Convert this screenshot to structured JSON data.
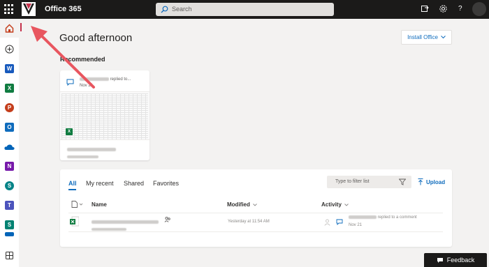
{
  "topbar": {
    "app_name": "Office 365",
    "search_placeholder": "Search",
    "icons": [
      "waffle-icon",
      "org-logo",
      "search-icon",
      "whats-new-icon",
      "settings-icon",
      "help-icon",
      "avatar"
    ],
    "help_label": "?"
  },
  "rail": {
    "items": [
      {
        "name": "home",
        "color": "#c43e1c"
      },
      {
        "name": "create",
        "color": "#323130"
      },
      {
        "name": "word",
        "color": "#185abd",
        "letter": "W"
      },
      {
        "name": "excel",
        "color": "#107c41",
        "letter": "X"
      },
      {
        "name": "powerpoint",
        "color": "#c43e1c",
        "letter": "P"
      },
      {
        "name": "outlook",
        "color": "#0f6cbd",
        "letter": "O"
      },
      {
        "name": "onedrive",
        "color": "#0364b8"
      },
      {
        "name": "onenote",
        "color": "#7719aa",
        "letter": "N"
      },
      {
        "name": "sharepoint",
        "color": "#038387",
        "letter": "S"
      },
      {
        "name": "teams",
        "color": "#4b53bc",
        "letter": "T"
      },
      {
        "name": "sway",
        "color": "#008272",
        "letter": "S"
      },
      {
        "name": "all-apps",
        "color": "#323130"
      }
    ]
  },
  "main": {
    "greeting": "Good afternoon",
    "install_label": "Install Office",
    "recommended_label": "Recommended",
    "card": {
      "activity": "replied to...",
      "date": "Nov 21"
    }
  },
  "files": {
    "tabs": [
      "All",
      "My recent",
      "Shared",
      "Favorites"
    ],
    "active_tab": "All",
    "filter_placeholder": "Type to filter list",
    "upload_label": "Upload",
    "columns": {
      "name": "Name",
      "modified": "Modified",
      "activity": "Activity"
    },
    "rows": [
      {
        "modified": "Yesterday at 11:54 AM",
        "activity_text": "replied to a comment",
        "activity_date": "Nov 21"
      }
    ]
  },
  "feedback_label": "Feedback",
  "colors": {
    "topbar": "#1b1a19",
    "accent": "#0f6cbd",
    "background": "#f3f2f1",
    "annotation": "#e8565f"
  }
}
